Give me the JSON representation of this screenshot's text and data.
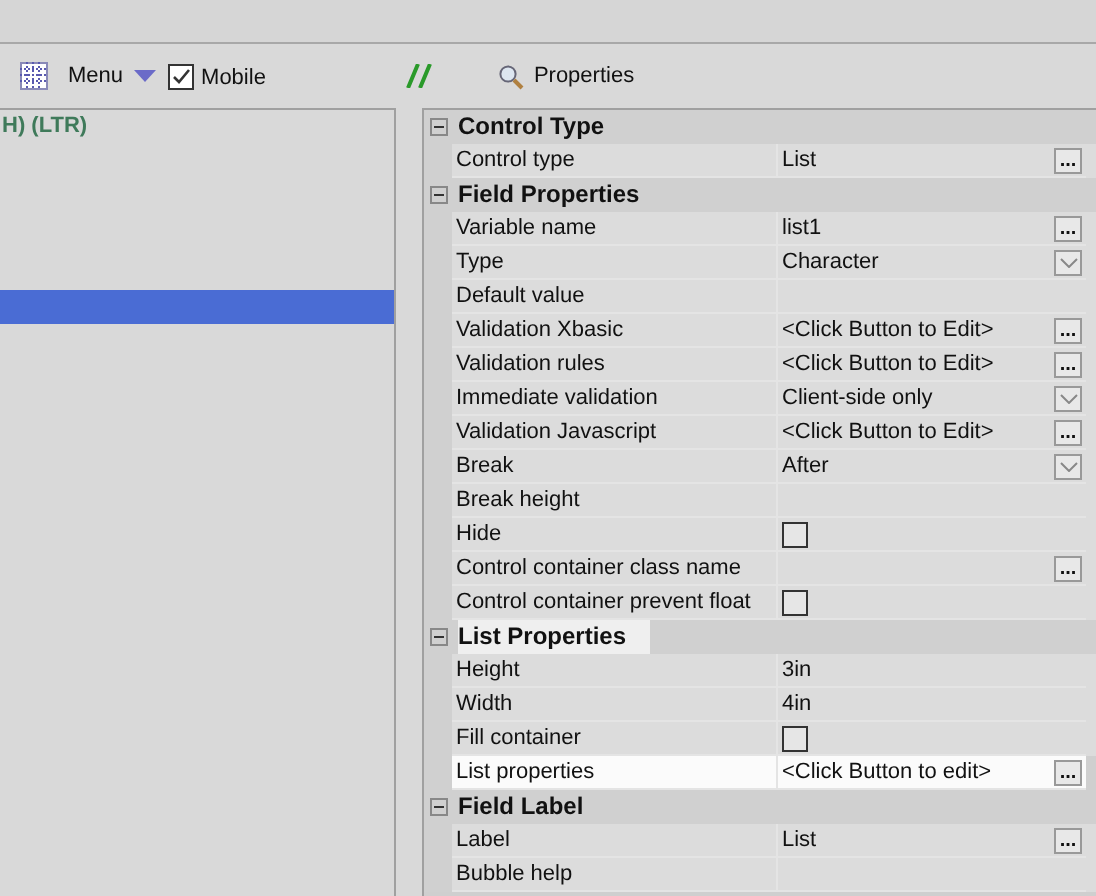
{
  "toolbar": {
    "menu_label": "Menu",
    "mobile": {
      "label": "Mobile",
      "checked": true
    },
    "properties_label": "Properties"
  },
  "tree": {
    "heading": "H) (LTR)",
    "selection_visible": true
  },
  "property_grid": {
    "sections": [
      {
        "title": "Control Type",
        "expanded": true,
        "highlighted": false,
        "rows": [
          {
            "label": "Control type",
            "kind": "text",
            "value": "List",
            "button": "...",
            "highlighted": false
          }
        ]
      },
      {
        "title": "Field Properties",
        "expanded": true,
        "highlighted": false,
        "rows": [
          {
            "label": "Variable name",
            "kind": "text",
            "value": "list1",
            "button": "...",
            "highlighted": false
          },
          {
            "label": "Type",
            "kind": "text",
            "value": "Character",
            "dropdown": true,
            "highlighted": false
          },
          {
            "label": "Default value",
            "kind": "text",
            "highlighted": false
          },
          {
            "label": "Validation Xbasic",
            "kind": "text",
            "value": "<Click Button to Edit>",
            "button": "...",
            "highlighted": false
          },
          {
            "label": "Validation rules",
            "kind": "text",
            "value": "<Click Button to Edit>",
            "button": "...",
            "highlighted": false
          },
          {
            "label": "Immediate validation",
            "kind": "text",
            "value": "Client-side only",
            "dropdown": true,
            "highlighted": false
          },
          {
            "label": "Validation Javascript",
            "kind": "text",
            "value": "<Click Button to Edit>",
            "button": "...",
            "highlighted": false
          },
          {
            "label": "Break",
            "kind": "text",
            "value": "After",
            "dropdown": true,
            "highlighted": false
          },
          {
            "label": "Break height",
            "kind": "text",
            "highlighted": false
          },
          {
            "label": "Hide",
            "kind": "checkbox",
            "checked": false,
            "highlighted": false
          },
          {
            "label": "Control container class name",
            "kind": "text",
            "button": "...",
            "highlighted": false
          },
          {
            "label": "Control container prevent float",
            "kind": "checkbox",
            "checked": false,
            "highlighted": false
          }
        ]
      },
      {
        "title": "List Properties",
        "expanded": true,
        "highlighted": true,
        "rows": [
          {
            "label": "Height",
            "kind": "text",
            "value": "3in",
            "highlighted": false
          },
          {
            "label": "Width",
            "kind": "text",
            "value": "4in",
            "highlighted": false
          },
          {
            "label": "Fill container",
            "kind": "checkbox",
            "checked": false,
            "highlighted": false
          },
          {
            "label": "List properties",
            "kind": "text",
            "value": "<Click Button to edit>",
            "button": "...",
            "highlighted": true
          }
        ]
      },
      {
        "title": "Field Label",
        "expanded": true,
        "highlighted": false,
        "rows": [
          {
            "label": "Label",
            "kind": "text",
            "value": "List",
            "button": "...",
            "highlighted": false
          },
          {
            "label": "Bubble help",
            "kind": "text",
            "highlighted": false
          }
        ]
      }
    ]
  }
}
